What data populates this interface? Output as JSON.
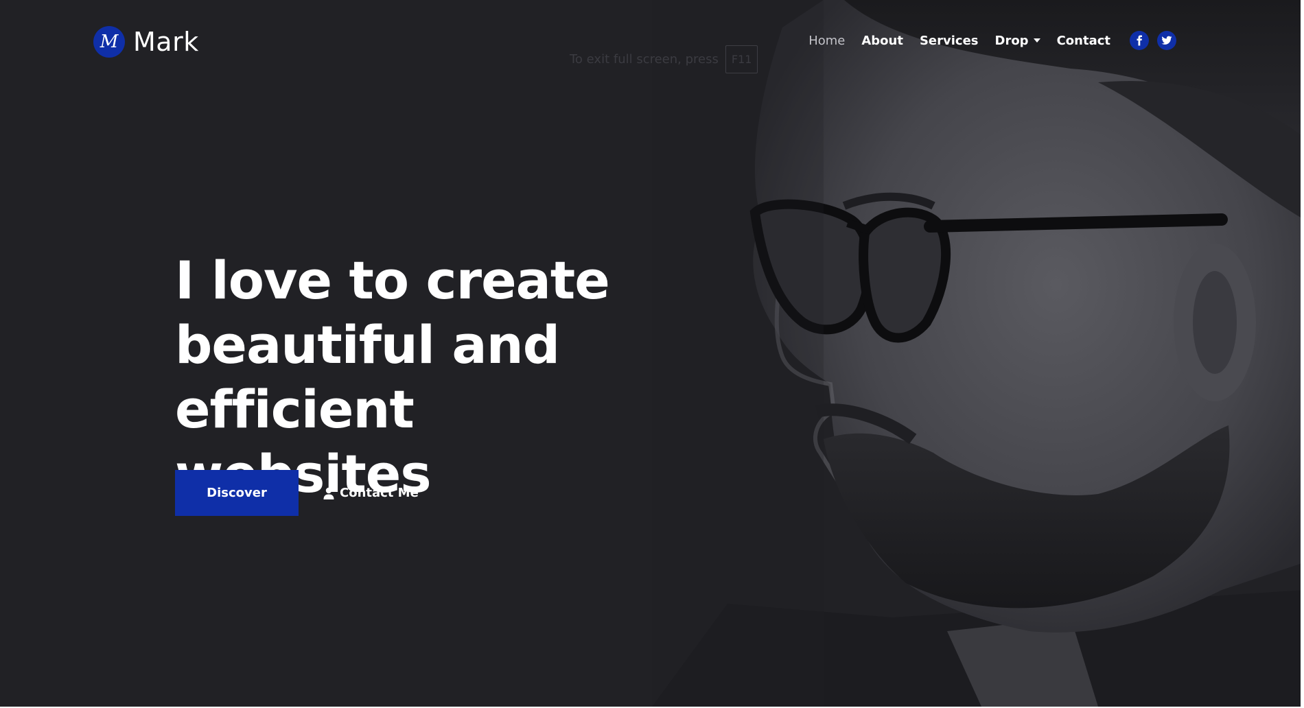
{
  "brand": {
    "logo_letter": "M",
    "name": "Mark",
    "accent": "#0f2fa8"
  },
  "fullscreen_hint": {
    "text": "To exit full screen, press",
    "key": "F11"
  },
  "nav": {
    "items": [
      {
        "label": "Home",
        "active": true
      },
      {
        "label": "About"
      },
      {
        "label": "Services"
      },
      {
        "label": "Drop",
        "has_dropdown": true
      },
      {
        "label": "Contact"
      }
    ],
    "socials": [
      {
        "icon": "facebook-icon"
      },
      {
        "icon": "twitter-icon"
      }
    ]
  },
  "hero": {
    "headline_line1": "I love to create",
    "headline_line2": "beautiful and",
    "headline_line3": "efficient websites",
    "primary_button": "Discover",
    "secondary_button": "Contact Me",
    "secondary_icon": "user-icon",
    "background": "#212125",
    "image": "grayscale portrait of bearded man wearing glasses, profile facing left"
  }
}
